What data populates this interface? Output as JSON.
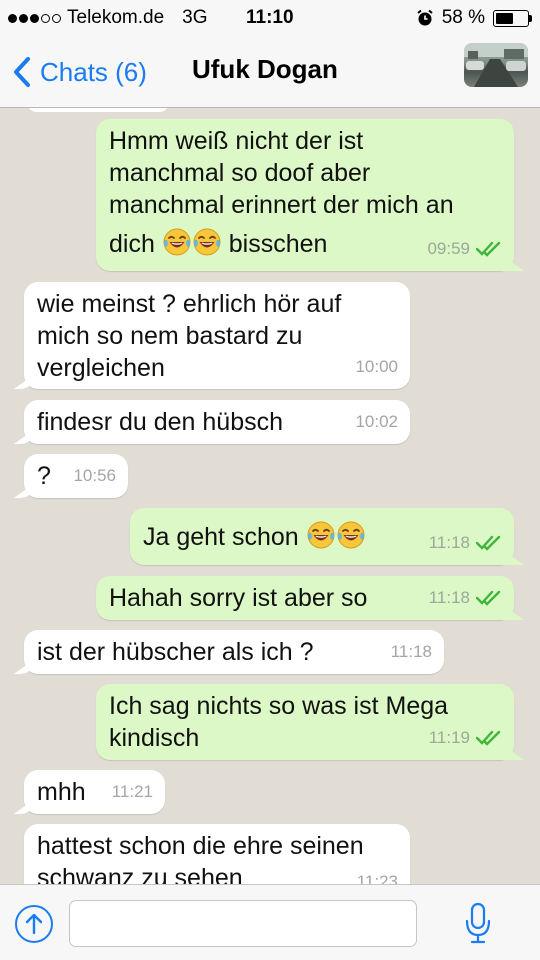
{
  "status_bar": {
    "carrier": "Telekom.de",
    "network": "3G",
    "time": "11:10",
    "battery": "58 %",
    "battery_level": 0.58,
    "signal_bars": 3,
    "signal_total": 5
  },
  "nav": {
    "back_label": "Chats (6)",
    "contact_name": "Ufuk Dogan"
  },
  "messages": [
    {
      "direction": "out",
      "lines": [
        "Hmm weiß nicht der ist",
        "manchmal so doof aber",
        "manchmal erinnert der mich an"
      ],
      "last_line_before": "dich ",
      "emojis": [
        "face-with-tears-of-joy-emoji",
        "face-with-tears-of-joy-emoji"
      ],
      "last_line_after": " bisschen",
      "time": "09:59",
      "read": true
    },
    {
      "direction": "in",
      "lines": [
        "wie meinst ? ehrlich hör auf",
        "mich so nem bastard zu",
        "vergleichen"
      ],
      "time": "10:00"
    },
    {
      "direction": "in",
      "lines": [
        "findesr du den hübsch"
      ],
      "time": "10:02"
    },
    {
      "direction": "in",
      "lines": [
        "?"
      ],
      "time": "10:56"
    },
    {
      "direction": "out",
      "lines": [],
      "last_line_before": "Ja geht schon ",
      "emojis": [
        "face-with-tears-of-joy-emoji",
        "face-with-tears-of-joy-emoji"
      ],
      "last_line_after": "",
      "time": "11:18",
      "read": true
    },
    {
      "direction": "out",
      "lines": [
        "Hahah sorry ist aber so"
      ],
      "time": "11:18",
      "read": true
    },
    {
      "direction": "in",
      "lines": [
        "ist der hübscher als ich ?"
      ],
      "time": "11:18"
    },
    {
      "direction": "out",
      "lines": [
        "Ich sag nichts so was ist Mega",
        "kindisch"
      ],
      "time": "11:19",
      "read": true
    },
    {
      "direction": "in",
      "lines": [
        "mhh"
      ],
      "time": "11:21"
    },
    {
      "direction": "in",
      "lines": [
        "hattest schon die ehre seinen",
        "schwanz zu sehen"
      ],
      "time": "11:23"
    }
  ],
  "input": {
    "placeholder": ""
  },
  "colors": {
    "accent": "#1a7cf3",
    "outgoing_bubble": "#dcf8c6",
    "incoming_bubble": "#ffffff",
    "chat_background": "#e1ddd5",
    "read_ticks": "#3fb53b"
  },
  "icons": {
    "upload": "arrow-up-circle-icon",
    "mic": "microphone-icon",
    "back": "chevron-left-icon",
    "alarm": "alarm-clock-icon",
    "ticks": "double-check-icon"
  }
}
